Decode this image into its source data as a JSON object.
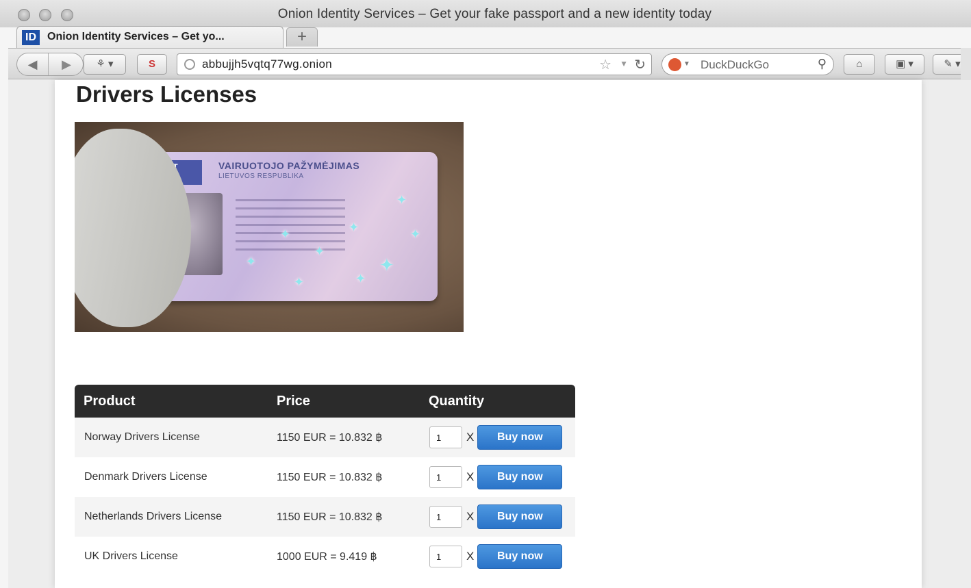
{
  "window": {
    "title": "Onion Identity Services – Get your fake passport and a new identity today"
  },
  "tab": {
    "favicon_text": "ID",
    "title": "Onion Identity Services – Get yo..."
  },
  "toolbar": {
    "url": "abbujjh5vqtq77wg.onion",
    "search_placeholder": "DuckDuckGo",
    "icons": [
      "back-icon",
      "forward-icon",
      "addon-icon",
      "bookmark-icon",
      "globe-icon",
      "star-icon",
      "reload-icon",
      "duckduckgo-icon",
      "search-icon",
      "home-icon",
      "screen-icon",
      "tool-icon"
    ]
  },
  "page": {
    "heading": "Drivers Licenses",
    "image": {
      "card_title": "VAIRUOTOJO PAŽYMĖJIMAS",
      "card_subtitle": "LIETUVOS RESPUBLIKA",
      "card_country": "LT"
    },
    "table": {
      "headers": [
        "Product",
        "Price",
        "Quantity"
      ],
      "rows": [
        {
          "product": "Norway Drivers License",
          "price": "1150 EUR = 10.832 ฿",
          "qty": "1",
          "times": "X",
          "button": "Buy now"
        },
        {
          "product": "Denmark Drivers License",
          "price": "1150 EUR = 10.832 ฿",
          "qty": "1",
          "times": "X",
          "button": "Buy now"
        },
        {
          "product": "Netherlands Drivers License",
          "price": "1150 EUR = 10.832 ฿",
          "qty": "1",
          "times": "X",
          "button": "Buy now"
        },
        {
          "product": "UK Drivers License",
          "price": "1000 EUR = 9.419 ฿",
          "qty": "1",
          "times": "X",
          "button": "Buy now"
        }
      ]
    }
  }
}
